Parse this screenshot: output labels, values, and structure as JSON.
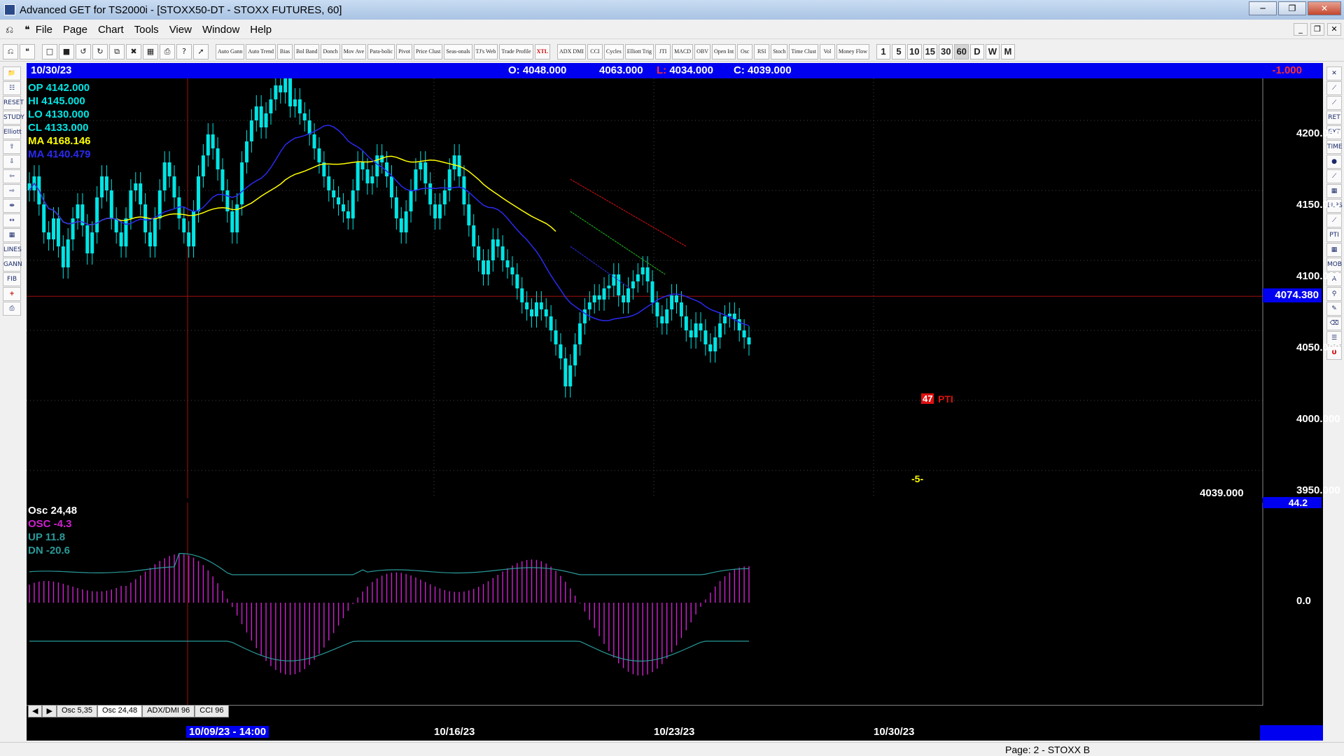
{
  "window": {
    "title": "Advanced GET for TS2000i - [STOXX50-DT - STOXX FUTURES, 60]"
  },
  "menu": [
    "File",
    "Page",
    "Chart",
    "Tools",
    "View",
    "Window",
    "Help"
  ],
  "toolbar": {
    "studies": [
      "Auto Gann",
      "Auto Trend",
      "Bias",
      "Bol Band",
      "Donch",
      "Mov Ave",
      "Para-bolic",
      "Pivot",
      "Price Clust",
      "Seas-onals",
      "TJ's Web",
      "Trade Profile",
      "XTL",
      "ADX DMI",
      "CCI",
      "Cycles",
      "Elliott Trig",
      "JTI",
      "MACD",
      "OBV",
      "Open Int",
      "Osc",
      "RSI",
      "Stoch",
      "Time Clust",
      "Vol",
      "Money Flow"
    ],
    "periods": [
      "1",
      "5",
      "10",
      "15",
      "30",
      "60",
      "D",
      "W",
      "M"
    ],
    "active_period": "60"
  },
  "info_bar": {
    "date": "10/30/23",
    "open": "O: 4048.000",
    "high": "4063.000",
    "low_label": "L:",
    "low": "4034.000",
    "close": "C: 4039.000",
    "change": "-1.000"
  },
  "legend": {
    "op": "OP  4142.000",
    "hi": "HI  4145.000",
    "lo": "LO  4130.000",
    "cl": "CL  4133.000",
    "ma1": "MA  4168.146",
    "ma2": "MA  4140.479"
  },
  "price_axis": [
    "4200.000",
    "4150.000",
    "4100.000",
    "4050.000",
    "4000.000",
    "3950.000"
  ],
  "cursor_price": "4074.380",
  "last_price": "4039.000",
  "pti": {
    "value": "47",
    "label": "PTI"
  },
  "wave_marker": "-5-",
  "oscillator": {
    "title": "Osc 24,48",
    "osc": "OSC -4.3",
    "up": "UP   11.8",
    "dn": "DN   -20.6",
    "axis_top": "44.2",
    "axis_zero": "0.0"
  },
  "osc_tabs": [
    "Osc 5,35",
    "Osc 24,48",
    "ADX/DMI 96",
    "CCI 96"
  ],
  "active_osc_tab": "Osc 24,48",
  "time_axis": [
    "10/09/23 - 14:00",
    "10/16/23",
    "10/23/23",
    "10/30/23"
  ],
  "status": {
    "page": "Page: 2 - STOXX B"
  },
  "colors": {
    "up_candle": "#00e5e5",
    "ma1": "#ffff00",
    "ma2": "#2a2af0",
    "osc": "#d020d0",
    "band": "#2a9a9a",
    "info": "#0000f0"
  },
  "chart_data": {
    "type": "candlestick",
    "price_range": [
      3930,
      4230
    ],
    "ohlc_closes": [
      4150,
      4160,
      4140,
      4120,
      4115,
      4130,
      4110,
      4095,
      4115,
      4130,
      4140,
      4125,
      4105,
      4120,
      4145,
      4160,
      4150,
      4130,
      4120,
      4110,
      4130,
      4150,
      4155,
      4140,
      4120,
      4110,
      4130,
      4150,
      4170,
      4160,
      4145,
      4130,
      4120,
      4110,
      4135,
      4160,
      4175,
      4190,
      4180,
      4165,
      4150,
      4135,
      4120,
      4140,
      4170,
      4185,
      4200,
      4210,
      4195,
      4205,
      4215,
      4225,
      4220,
      4230,
      4210,
      4215,
      4205,
      4200,
      4190,
      4180,
      4170,
      4160,
      4150,
      4145,
      4140,
      4135,
      4130,
      4150,
      4170,
      4165,
      4155,
      4160,
      4175,
      4170,
      4160,
      4145,
      4130,
      4120,
      4135,
      4150,
      4165,
      4170,
      4155,
      4140,
      4130,
      4140,
      4150,
      4165,
      4175,
      4160,
      4140,
      4125,
      4110,
      4100,
      4090,
      4100,
      4115,
      4110,
      4100,
      4095,
      4090,
      4080,
      4070,
      4065,
      4060,
      4070,
      4065,
      4060,
      4050,
      4040,
      4030,
      4010,
      4025,
      4040,
      4055,
      4065,
      4070,
      4075,
      4072,
      4080,
      4082,
      4090,
      4075,
      4070,
      4080,
      4085,
      4090,
      4095,
      4085,
      4070,
      4060,
      4055,
      4065,
      4075,
      4070,
      4060,
      4050,
      4045,
      4055,
      4050,
      4040,
      4035,
      4045,
      4055,
      4060,
      4062,
      4058,
      4050,
      4045,
      4040
    ],
    "series": [
      {
        "name": "MA 4168.146"
      },
      {
        "name": "MA 4140.479"
      }
    ]
  }
}
